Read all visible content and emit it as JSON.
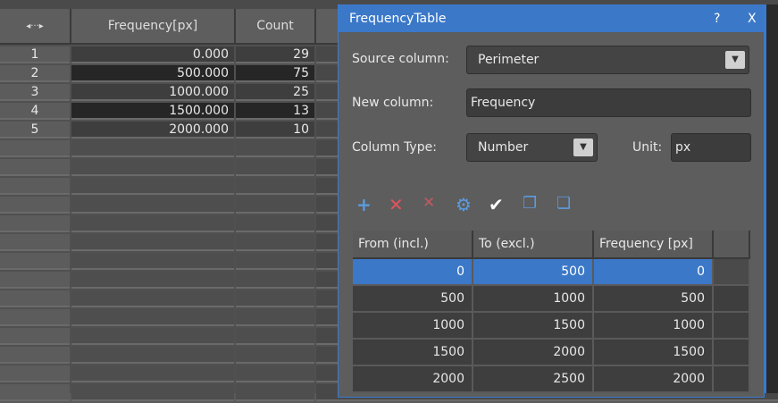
{
  "grid": {
    "headers": [
      "Frequency[px]",
      "Count"
    ],
    "rows": [
      {
        "n": "1",
        "freq": "0.000",
        "count": "29"
      },
      {
        "n": "2",
        "freq": "500.000",
        "count": "75"
      },
      {
        "n": "3",
        "freq": "1000.000",
        "count": "25"
      },
      {
        "n": "4",
        "freq": "1500.000",
        "count": "13"
      },
      {
        "n": "5",
        "freq": "2000.000",
        "count": "10"
      }
    ]
  },
  "dialog": {
    "title": "FrequencyTable",
    "help": "?",
    "close": "X",
    "source_label": "Source column:",
    "source_value": "Perimeter",
    "newcol_label": "New column:",
    "newcol_value": "Frequency",
    "type_label": "Column Type:",
    "type_value": "Number",
    "unit_label": "Unit:",
    "unit_value": "px",
    "table": {
      "headers": [
        "From (incl.)",
        "To (excl.)",
        "Frequency [px]"
      ],
      "rows": [
        [
          "0",
          "500",
          "0"
        ],
        [
          "500",
          "1000",
          "500"
        ],
        [
          "1000",
          "1500",
          "1000"
        ],
        [
          "1500",
          "2000",
          "1500"
        ],
        [
          "2000",
          "2500",
          "2000"
        ]
      ]
    }
  }
}
